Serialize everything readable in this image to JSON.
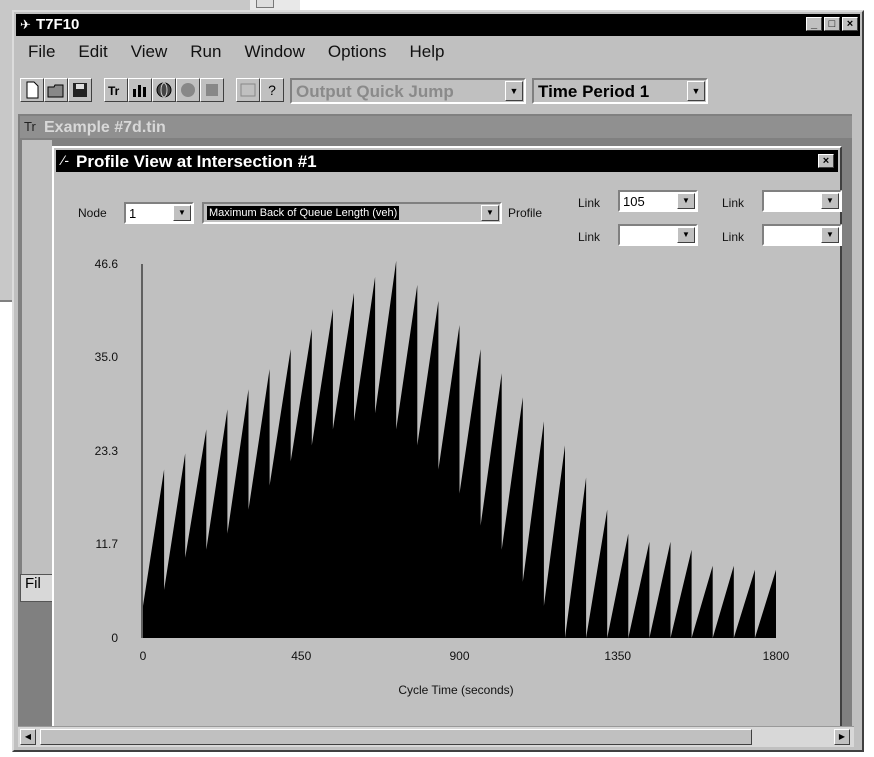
{
  "window": {
    "title": "T7F10",
    "min_label": "_",
    "max_label": "□",
    "close_label": "×"
  },
  "menu": [
    {
      "label": "File"
    },
    {
      "label": "Edit"
    },
    {
      "label": "View"
    },
    {
      "label": "Run"
    },
    {
      "label": "Window"
    },
    {
      "label": "Options"
    },
    {
      "label": "Help"
    }
  ],
  "toolbar": {
    "output_quick_jump": "Output Quick Jump",
    "time_period": "Time Period 1",
    "help_glyph": "?"
  },
  "child_window": {
    "title": "Example #7d.tin",
    "tab_label": "Fil"
  },
  "profile_window": {
    "title": "Profile View at Intersection #1",
    "close_label": "×",
    "node_label": "Node",
    "node_value": "1",
    "measure_value": "Maximum Back of Queue Length (veh)",
    "profile_label": "Profile",
    "link_label": "Link",
    "link1_value": "105",
    "link2_value": "",
    "link3_value": "",
    "link4_value": ""
  },
  "chart_data": {
    "type": "area",
    "xlabel": "Cycle Time (seconds)",
    "ylabel": "",
    "xlim": [
      0,
      1800
    ],
    "ylim": [
      0,
      46.6
    ],
    "x_ticks": [
      "0",
      "450",
      "900",
      "1350",
      "1800"
    ],
    "y_ticks": [
      "0",
      "11.7",
      "23.3",
      "35.0",
      "46.6"
    ],
    "fill_color": "#000000",
    "x": [
      0,
      60,
      60,
      120,
      120,
      180,
      180,
      240,
      240,
      300,
      300,
      360,
      360,
      420,
      420,
      480,
      480,
      540,
      540,
      600,
      600,
      660,
      660,
      720,
      720,
      780,
      780,
      840,
      840,
      900,
      900,
      960,
      960,
      1020,
      1020,
      1080,
      1080,
      1140,
      1140,
      1200,
      1200,
      1260,
      1260,
      1320,
      1320,
      1380,
      1380,
      1440,
      1440,
      1500,
      1500,
      1560,
      1560,
      1620,
      1620,
      1680,
      1680,
      1740,
      1740,
      1800
    ],
    "y": [
      4,
      21,
      6,
      23,
      10,
      26,
      11,
      28.5,
      13,
      31,
      16,
      33.5,
      19,
      36,
      22,
      38.5,
      24,
      41,
      26,
      43,
      27,
      45,
      28,
      47,
      26,
      44,
      24,
      42,
      21,
      39,
      18,
      36,
      14,
      33,
      11,
      30,
      7,
      27,
      4,
      24,
      0,
      20,
      0,
      16,
      0,
      13,
      0,
      12,
      0,
      12,
      0,
      11,
      0,
      9,
      0,
      9,
      0,
      8.5,
      0,
      8.5
    ]
  }
}
